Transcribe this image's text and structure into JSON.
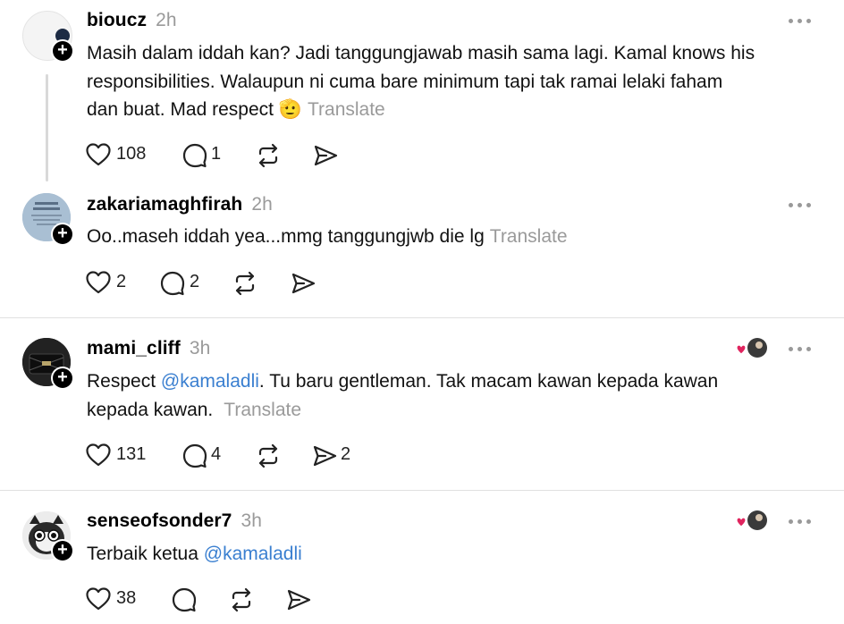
{
  "posts": [
    {
      "username": "bioucz",
      "time": "2h",
      "text_lines": [
        "Masih dalam iddah kan? Jadi tanggungjawab masih sama lagi. Kamal knows his",
        "responsibilities. Walaupun ni cuma bare minimum tapi tak ramai lelaki faham"
      ],
      "text_last": "dan buat. Mad respect",
      "emoji": "🫡",
      "translate": "Translate",
      "likes": "108",
      "replies": "1",
      "reposts": "",
      "shares": ""
    },
    {
      "username": "zakariamaghfirah",
      "time": "2h",
      "text": "Oo..maseh iddah yea...mmg tanggungjwb die lg",
      "translate": "Translate",
      "likes": "2",
      "replies": "2",
      "reposts": "",
      "shares": ""
    },
    {
      "username": "mami_cliff",
      "time": "3h",
      "text_pre": "Respect ",
      "mention": "@kamaladli",
      "text_post": ". Tu baru gentleman. Tak macam kawan kepada kawan",
      "text_line2": "kepada kawan.",
      "translate": "Translate",
      "likes": "131",
      "replies": "4",
      "reposts": "",
      "shares": "2"
    },
    {
      "username": "senseofsonder7",
      "time": "3h",
      "text_pre": "Terbaik ketua ",
      "mention": "@kamaladli",
      "likes": "38",
      "replies": "",
      "reposts": "",
      "shares": ""
    }
  ],
  "colors": {
    "muted": "#9a9a9a",
    "mention": "#3a7fd0",
    "heart": "#e0245e"
  },
  "icons": [
    "plus-icon",
    "more-icon",
    "heart-icon",
    "reply-icon",
    "repost-icon",
    "share-icon",
    "liked-by-author-icon"
  ]
}
